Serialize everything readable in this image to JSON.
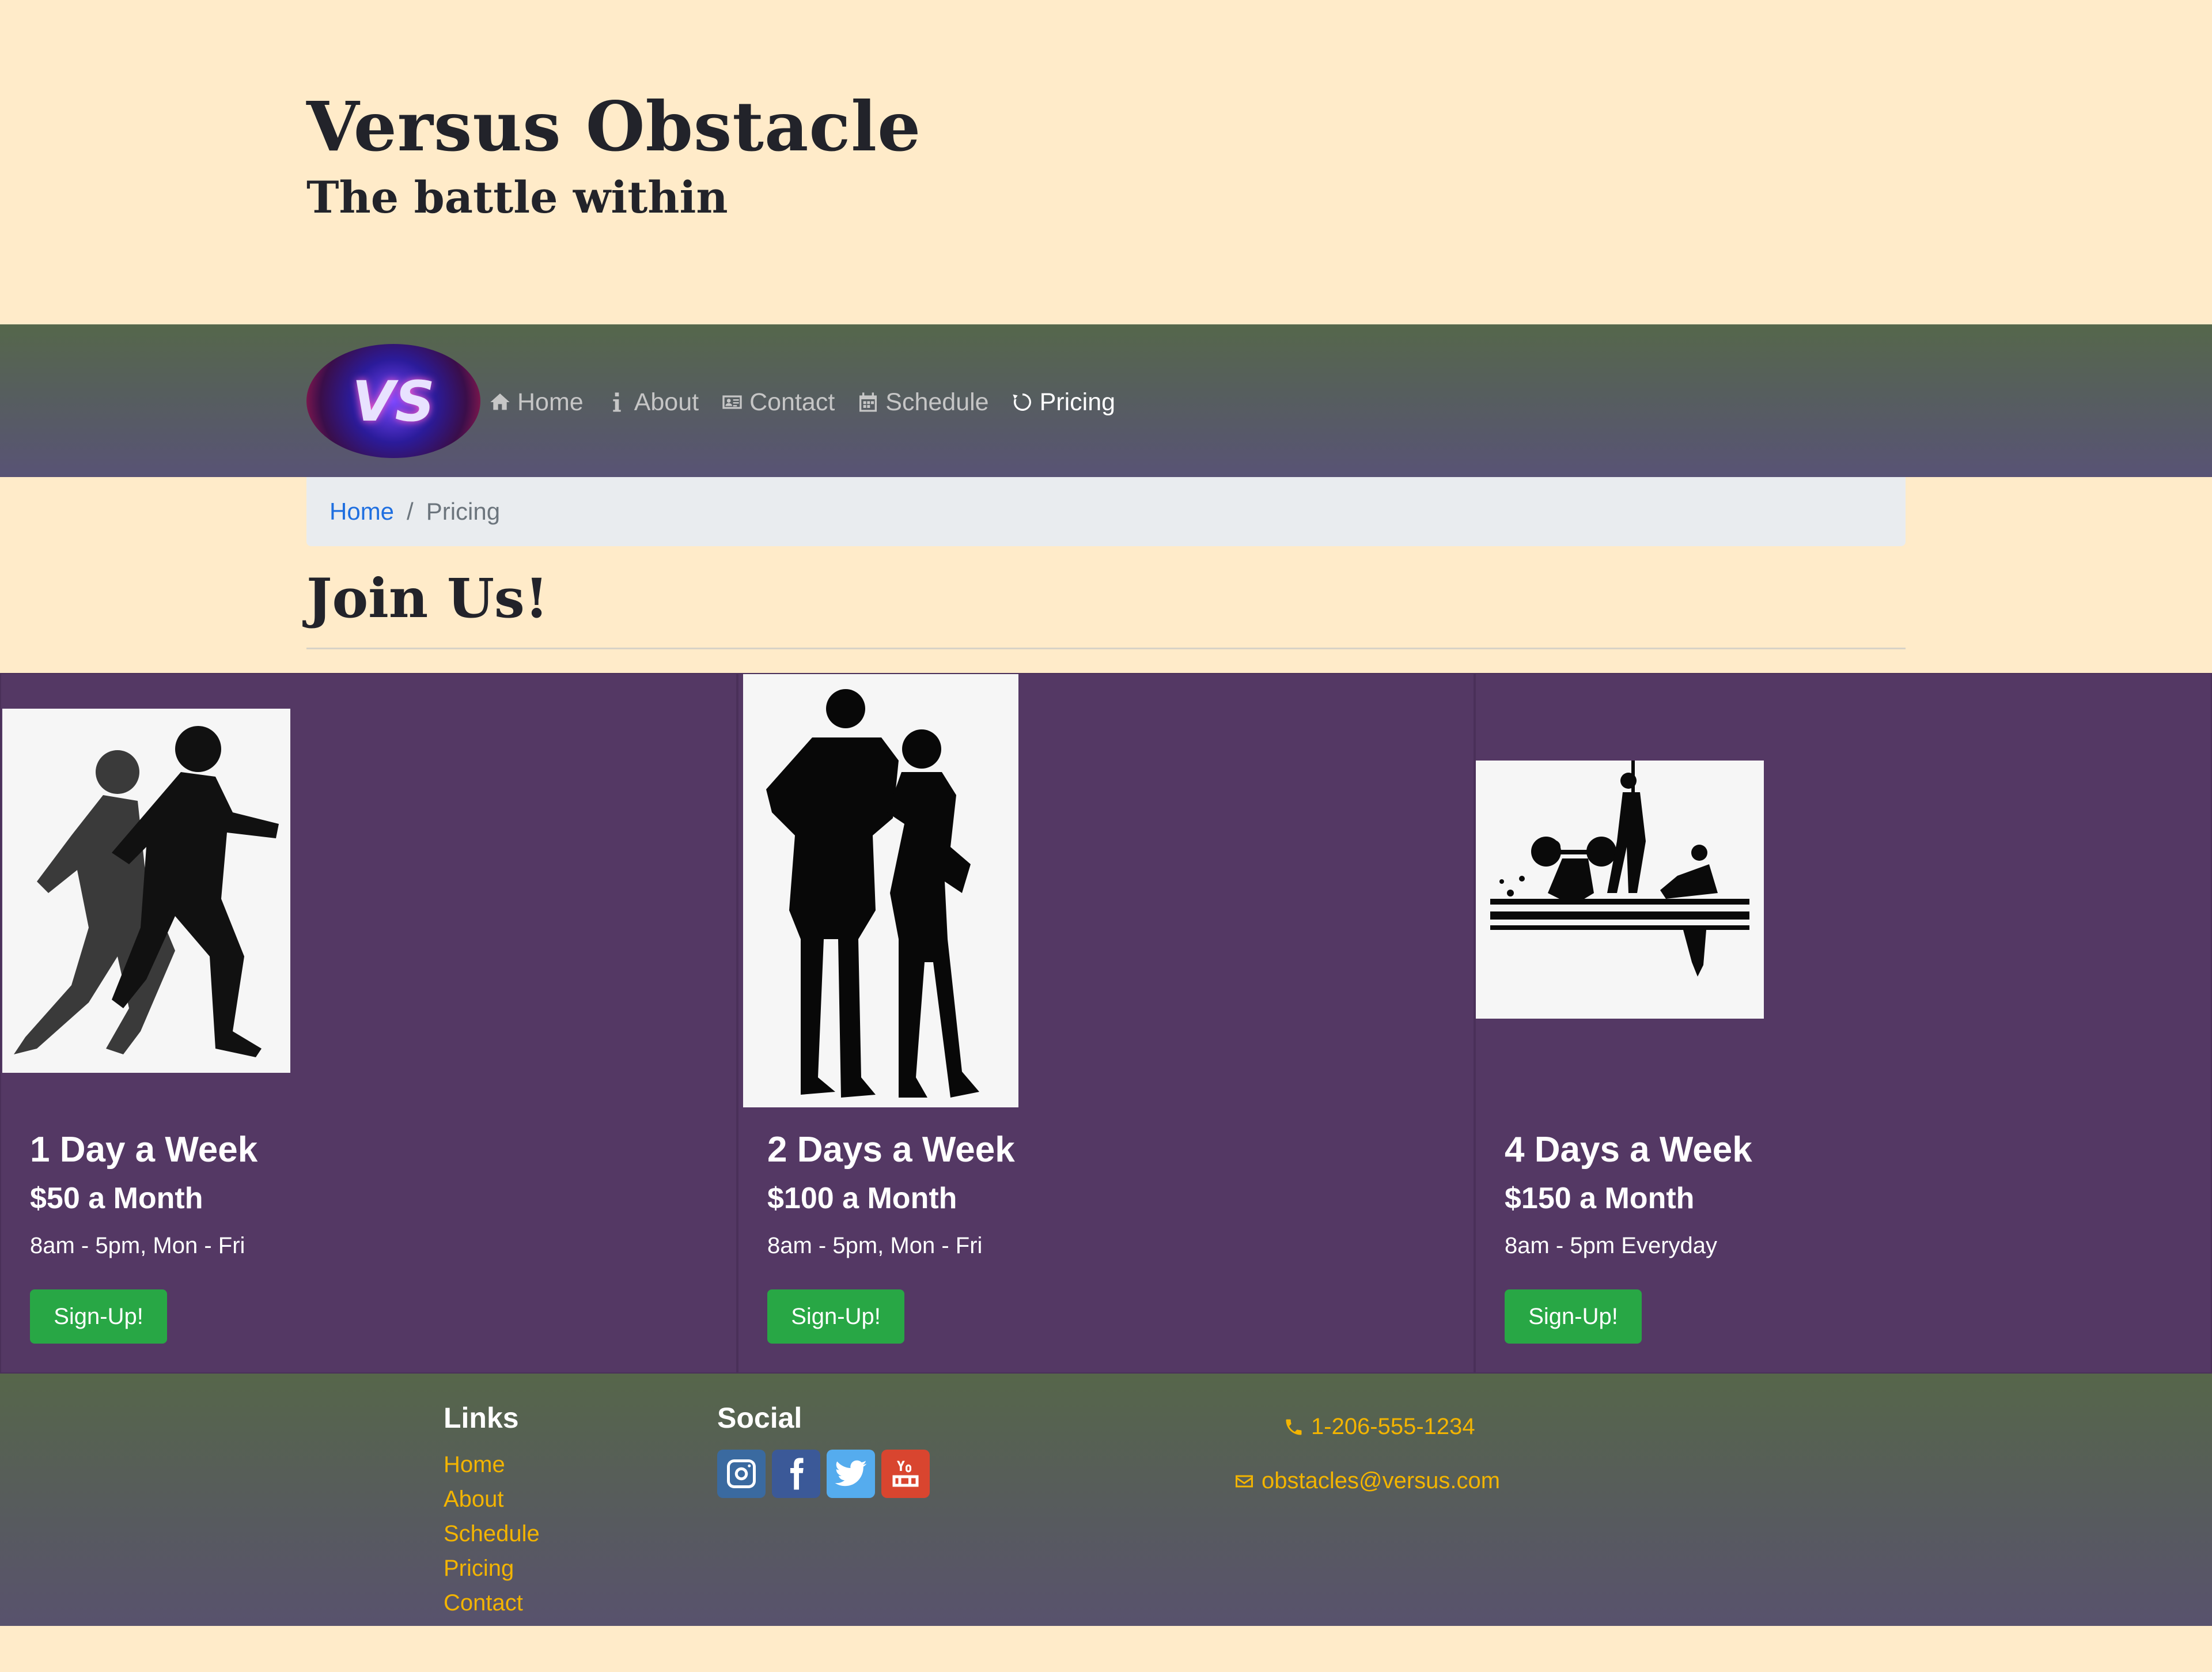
{
  "header": {
    "title": "Versus Obstacle",
    "subtitle": "The battle within"
  },
  "nav": {
    "logo_text": "VS",
    "items": [
      {
        "label": "Home",
        "icon": "home-icon"
      },
      {
        "label": "About",
        "icon": "info-icon"
      },
      {
        "label": "Contact",
        "icon": "address-card-icon"
      },
      {
        "label": "Schedule",
        "icon": "calendar-icon"
      },
      {
        "label": "Pricing",
        "icon": "refresh-icon",
        "active": true
      }
    ]
  },
  "breadcrumb": {
    "home": "Home",
    "separator": "/",
    "current": "Pricing"
  },
  "page": {
    "heading": "Join Us!"
  },
  "plans": [
    {
      "title": "1 Day a Week",
      "price": "$50 a Month",
      "hours": "8am - 5pm, Mon - Fri",
      "button": "Sign-Up!",
      "image": "runners-silhouette"
    },
    {
      "title": "2 Days a Week",
      "price": "$100 a Month",
      "hours": "8am - 5pm, Mon - Fri",
      "button": "Sign-Up!",
      "image": "couple-silhouette"
    },
    {
      "title": "4 Days a Week",
      "price": "$150 a Month",
      "hours": "8am - 5pm Everyday",
      "button": "Sign-Up!",
      "image": "fitness-group-silhouette"
    }
  ],
  "footer": {
    "links_heading": "Links",
    "links": [
      "Home",
      "About",
      "Schedule",
      "Pricing",
      "Contact"
    ],
    "social_heading": "Social",
    "social": [
      {
        "name": "instagram-icon",
        "color": "#3a6aa0"
      },
      {
        "name": "facebook-icon",
        "color": "#3b5998"
      },
      {
        "name": "twitter-icon",
        "color": "#55acee"
      },
      {
        "name": "youtube-icon",
        "color": "#d9452f"
      }
    ],
    "phone": "1-206-555-1234",
    "email": "obstacles@versus.com"
  },
  "colors": {
    "page_bg": "#ffebc9",
    "card_bg": "#543864",
    "button": "#28a745",
    "link_accent": "#f3b400",
    "breadcrumb_link": "#1f6fe0"
  }
}
